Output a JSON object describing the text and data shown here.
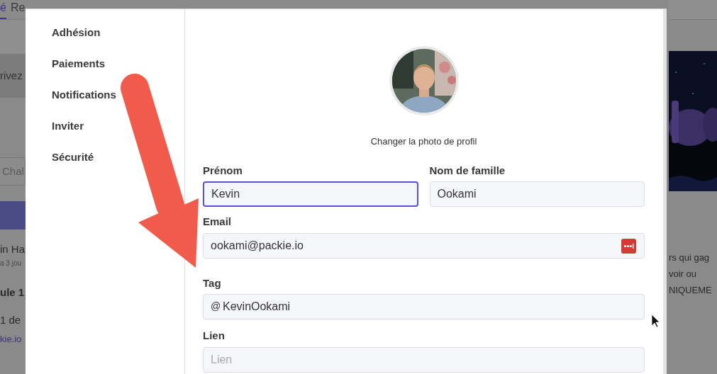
{
  "background": {
    "tabs": [
      {
        "label": "é",
        "selected": true
      },
      {
        "label": "Re",
        "selected": false
      }
    ],
    "intro": "rivez",
    "search_placeholder": "Chal",
    "author": "in Ha",
    "time": "a 3 jou",
    "heading": "ule 1",
    "line": "1 de",
    "link": "kie.io",
    "right_lines": [
      "rs qui gag",
      "voir ou",
      "NIQUEME"
    ]
  },
  "modal": {
    "menu": [
      "Adhésion",
      "Paiements",
      "Notifications",
      "Inviter",
      "Sécurité"
    ],
    "photo_link": "Changer la photo de profil",
    "first_name": {
      "label": "Prénom",
      "value": "Kevin",
      "focused": true
    },
    "last_name": {
      "label": "Nom de famille",
      "value": "Ookami",
      "focused": false
    },
    "email": {
      "label": "Email",
      "value": "ookami@packie.io",
      "focused": false
    },
    "tag": {
      "label": "Tag",
      "prefix": "@",
      "value": "KevinOokami",
      "focused": false
    },
    "link": {
      "label": "Lien",
      "placeholder": "Lien",
      "focused": false
    }
  }
}
